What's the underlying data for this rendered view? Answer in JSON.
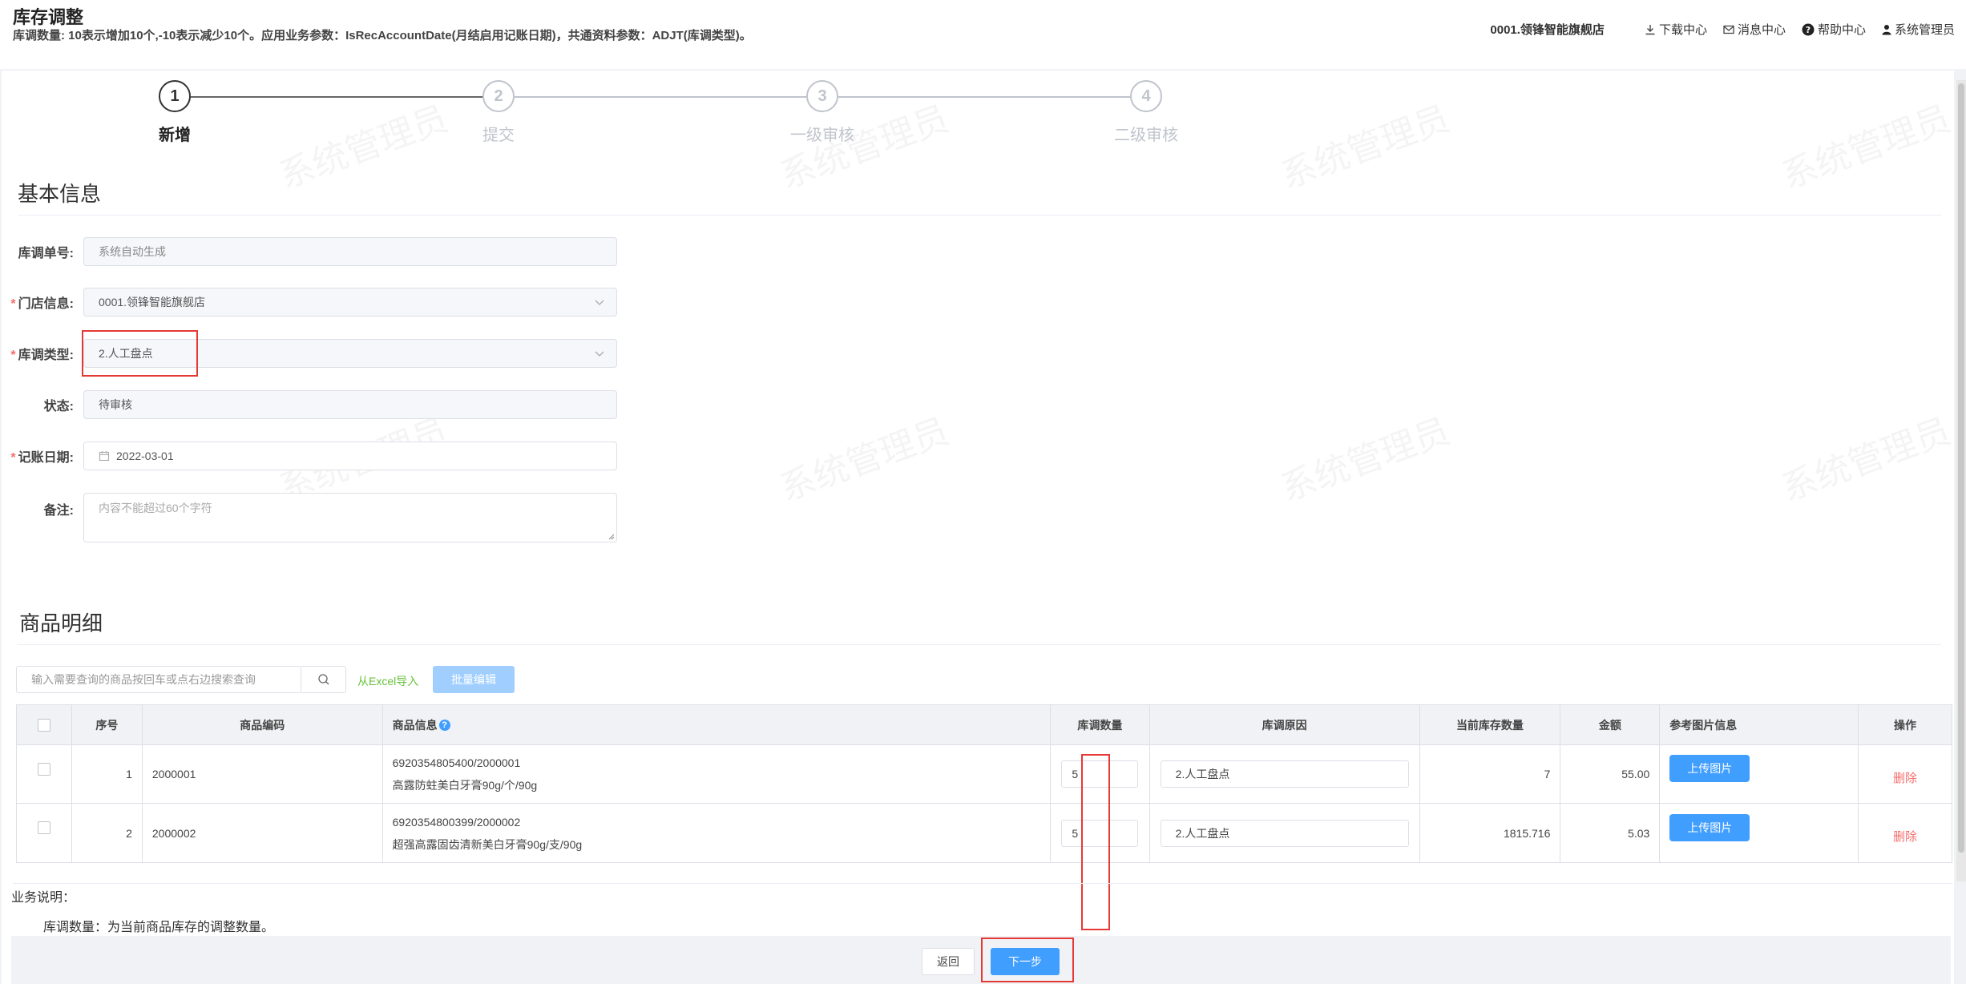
{
  "header": {
    "title": "库存调整",
    "description": "库调数量: 10表示增加10个,-10表示减少10个。应用业务参数：IsRecAccountDate(月结启用记账日期)，共通资料参数：ADJT(库调类型)。",
    "store": "0001.领锋智能旗舰店",
    "nav": {
      "download": "下载中心",
      "messages": "消息中心",
      "help": "帮助中心",
      "user": "系统管理员"
    }
  },
  "steps": [
    {
      "number": "1",
      "label": "新增"
    },
    {
      "number": "2",
      "label": "提交"
    },
    {
      "number": "3",
      "label": "一级审核"
    },
    {
      "number": "4",
      "label": "二级审核"
    }
  ],
  "watermark": "系统管理员",
  "basic_info": {
    "section_title": "基本信息",
    "order_no": {
      "label": "库调单号:",
      "placeholder": "系统自动生成"
    },
    "store": {
      "label": "门店信息:",
      "value": "0001.领锋智能旗舰店"
    },
    "adjust_type": {
      "label": "库调类型:",
      "value": "2.人工盘点"
    },
    "status": {
      "label": "状态:",
      "value": "待审核"
    },
    "date": {
      "label": "记账日期:",
      "value": "2022-03-01"
    },
    "remark": {
      "label": "备注:",
      "placeholder": "内容不能超过60个字符"
    }
  },
  "details": {
    "section_title": "商品明细",
    "search_placeholder": "输入需要查询的商品按回车或点右边搜索查询",
    "excel_import": "从Excel导入",
    "batch_edit": "批量编辑",
    "columns": {
      "no": "序号",
      "code": "商品编码",
      "info": "商品信息",
      "qty": "库调数量",
      "reason": "库调原因",
      "stock": "当前库存数量",
      "amount": "金额",
      "images": "参考图片信息",
      "operation": "操作"
    },
    "rows": [
      {
        "no": "1",
        "code": "2000001",
        "barcode": "6920354805400/2000001",
        "name": "高露防蛀美白牙膏90g/个/90g",
        "qty": "5",
        "reason": "2.人工盘点",
        "stock": "7",
        "amount": "55.00",
        "upload": "上传图片",
        "delete": "删除"
      },
      {
        "no": "2",
        "code": "2000002",
        "barcode": "6920354800399/2000002",
        "name": "超强高露固齿清新美白牙膏90g/支/90g",
        "qty": "5",
        "reason": "2.人工盘点",
        "stock": "1815.716",
        "amount": "5.03",
        "upload": "上传图片",
        "delete": "删除"
      }
    ]
  },
  "business_notes": {
    "title": "业务说明：",
    "text": "库调数量：为当前商品库存的调整数量。"
  },
  "footer": {
    "back": "返回",
    "next": "下一步"
  }
}
